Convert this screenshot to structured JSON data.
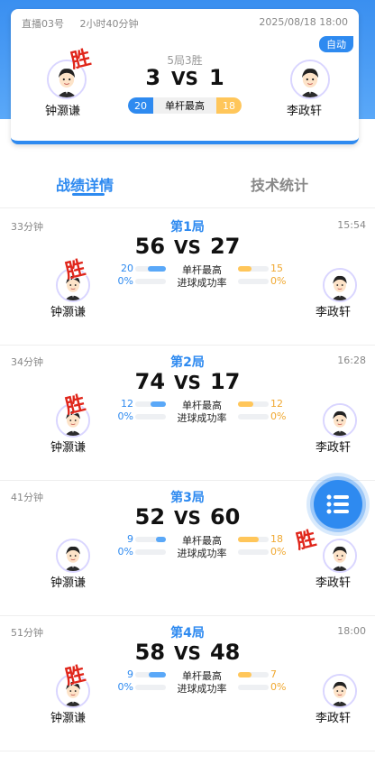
{
  "summary": {
    "room": "直播03号",
    "duration": "2小时40分钟",
    "datetime": "2025/08/18 18:00",
    "auto_label": "自动",
    "result_text": "5局3胜",
    "left_player": "钟灏谦",
    "right_player": "李政轩",
    "left_score": "3",
    "right_score": "1",
    "vs": "VS",
    "win_mark": "胜",
    "best_left": "20",
    "best_label": "单杆最高",
    "best_right": "18"
  },
  "tabs": [
    {
      "label": "战绩详情",
      "active": true
    },
    {
      "label": "技术统计",
      "active": false
    }
  ],
  "labels": {
    "best": "单杆最高",
    "success": "进球成功率",
    "vs": "VS",
    "win": "胜"
  },
  "games": [
    {
      "duration": "33分钟",
      "title": "第1局",
      "time": "15:54",
      "left_score": "56",
      "right_score": "27",
      "left_best": "20",
      "right_best": "15",
      "left_best_frac": 0.6,
      "right_best_frac": 0.45,
      "left_rate": "0%",
      "right_rate": "0%",
      "winner": "left",
      "left_player": "钟灏谦",
      "right_player": "李政轩"
    },
    {
      "duration": "34分钟",
      "title": "第2局",
      "time": "16:28",
      "left_score": "74",
      "right_score": "17",
      "left_best": "12",
      "right_best": "12",
      "left_best_frac": 0.5,
      "right_best_frac": 0.5,
      "left_rate": "0%",
      "right_rate": "0%",
      "winner": "left",
      "left_player": "钟灏谦",
      "right_player": "李政轩"
    },
    {
      "duration": "41分钟",
      "title": "第3局",
      "time": "",
      "left_score": "52",
      "right_score": "60",
      "left_best": "9",
      "right_best": "18",
      "left_best_frac": 0.33,
      "right_best_frac": 0.67,
      "left_rate": "0%",
      "right_rate": "0%",
      "winner": "right",
      "left_player": "钟灏谦",
      "right_player": "李政轩"
    },
    {
      "duration": "51分钟",
      "title": "第4局",
      "time": "18:00",
      "left_score": "58",
      "right_score": "48",
      "left_best": "9",
      "right_best": "7",
      "left_best_frac": 0.56,
      "right_best_frac": 0.44,
      "left_rate": "0%",
      "right_rate": "0%",
      "winner": "left",
      "left_player": "钟灏谦",
      "right_player": "李政轩"
    }
  ],
  "fab_icon": "list-icon",
  "colors": {
    "accent": "#2e8af0",
    "win": "#e0261b",
    "right_accent": "#ffc65a"
  }
}
